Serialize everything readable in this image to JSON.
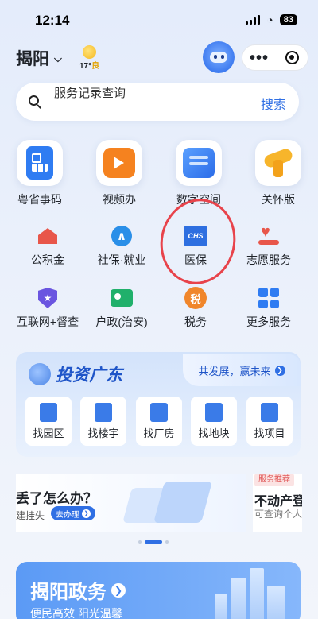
{
  "status_bar": {
    "time": "12:14",
    "battery": "83"
  },
  "header": {
    "city": "揭阳",
    "weather": {
      "temp": "17°",
      "level": "良"
    }
  },
  "search": {
    "placeholder": "服务记录查询",
    "button": "搜索"
  },
  "tiles": [
    {
      "label": "粤省事码",
      "icon": "qr-code-icon"
    },
    {
      "label": "视频办",
      "icon": "video-icon"
    },
    {
      "label": "数字空间",
      "icon": "digital-space-icon"
    },
    {
      "label": "关怀版",
      "icon": "care-ribbon-icon"
    }
  ],
  "services_row1": [
    {
      "label": "公积金",
      "icon": "house-fund-icon"
    },
    {
      "label": "社保·就业",
      "icon": "social-security-icon"
    },
    {
      "label": "医保",
      "icon": "chs-medical-icon",
      "icon_text": "CHS"
    },
    {
      "label": "志愿服务",
      "icon": "volunteer-heart-icon"
    }
  ],
  "services_row2": [
    {
      "label": "互联网+督查",
      "icon": "shield-star-icon"
    },
    {
      "label": "户政(治安)",
      "icon": "household-id-icon"
    },
    {
      "label": "税务",
      "icon": "tax-icon",
      "icon_text": "税"
    },
    {
      "label": "更多服务",
      "icon": "more-grid-icon"
    }
  ],
  "invest": {
    "title": "投资广东",
    "slogan": "共发展，赢未来",
    "items": [
      {
        "label": "找园区"
      },
      {
        "label": "找楼宇"
      },
      {
        "label": "找厂房"
      },
      {
        "label": "找地块"
      },
      {
        "label": "找项目"
      }
    ]
  },
  "banner": {
    "left_title": "丢了怎么办？",
    "left_sub": "建挂失",
    "left_button": "去办理",
    "right_tag": "服务推荐",
    "right_title": "不动产登",
    "right_sub": "可查询个人"
  },
  "gov_card": {
    "title": "揭阳政务",
    "subtitle": "便民高效 阳光温馨"
  },
  "colors": {
    "accent": "#2f6fe4",
    "annotation": "#e8434b"
  }
}
